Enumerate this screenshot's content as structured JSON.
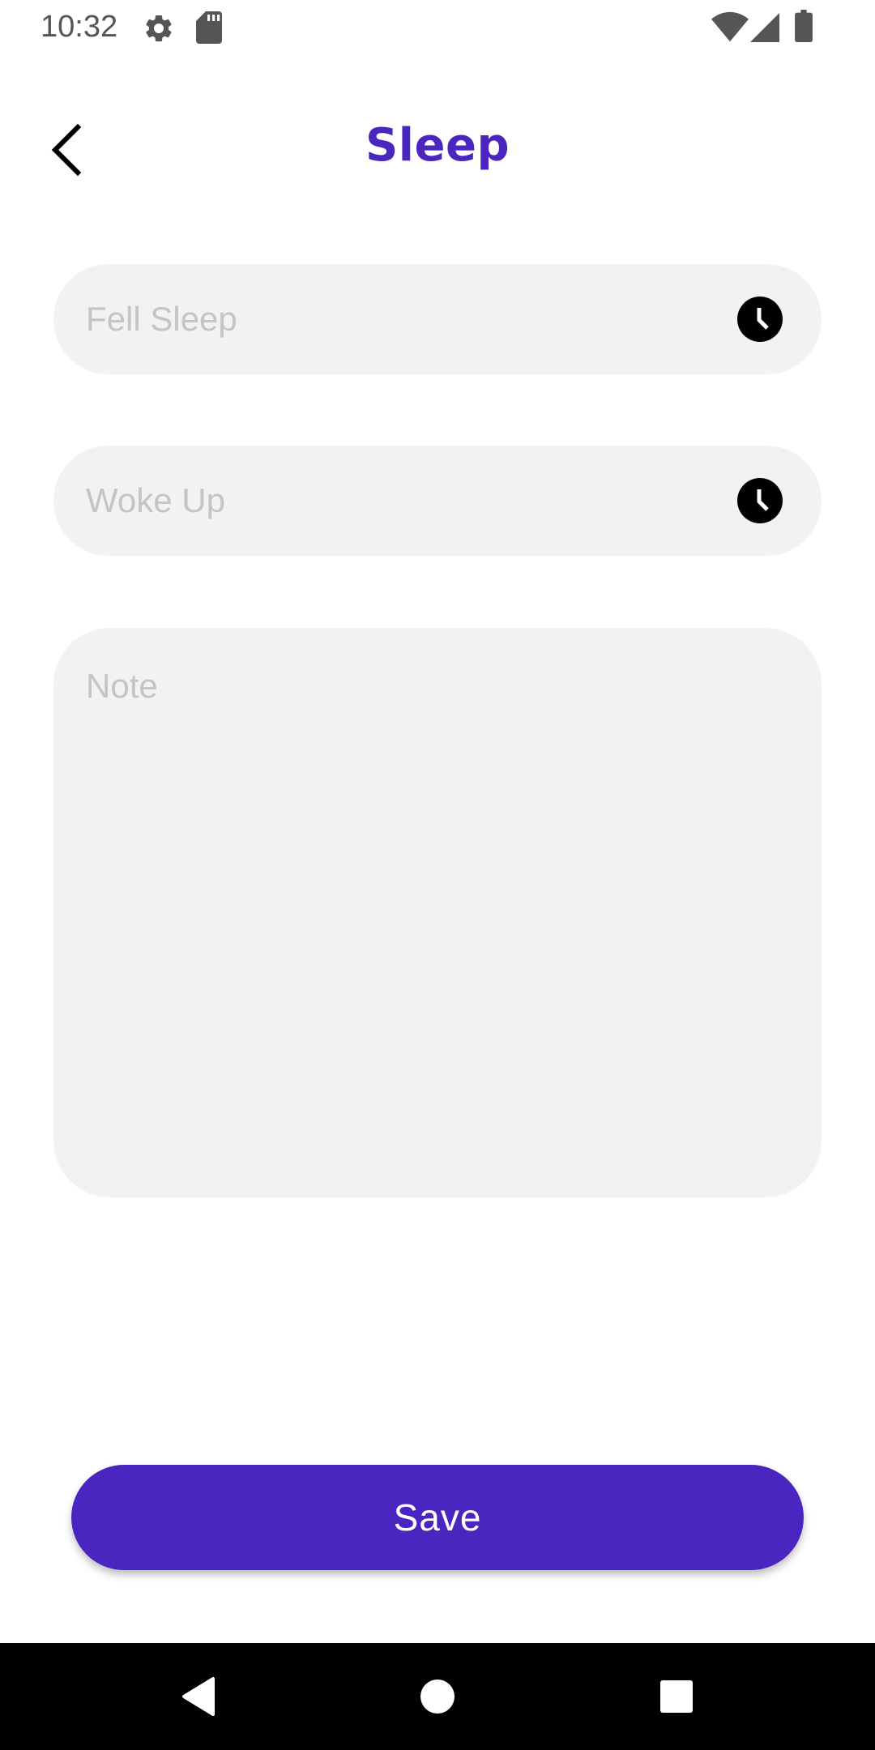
{
  "status_bar": {
    "time": "10:32",
    "icons": [
      "gear-icon",
      "sd-card-icon",
      "wifi-icon",
      "cell-signal-icon",
      "battery-icon"
    ]
  },
  "header": {
    "title": "Sleep",
    "back_icon": "chevron-left-icon"
  },
  "form": {
    "fell_sleep": {
      "placeholder": "Fell Sleep",
      "value": "",
      "icon": "clock-icon"
    },
    "woke_up": {
      "placeholder": "Woke Up",
      "value": "",
      "icon": "clock-icon"
    },
    "note": {
      "placeholder": "Note",
      "value": ""
    },
    "save_label": "Save"
  },
  "nav_bar": {
    "icons": [
      "nav-back-icon",
      "nav-home-icon",
      "nav-recents-icon"
    ]
  },
  "colors": {
    "accent": "#4a25c0",
    "field_background": "#f2f2f2",
    "placeholder_text": "#c4c4c4",
    "nav_background": "#000000"
  }
}
